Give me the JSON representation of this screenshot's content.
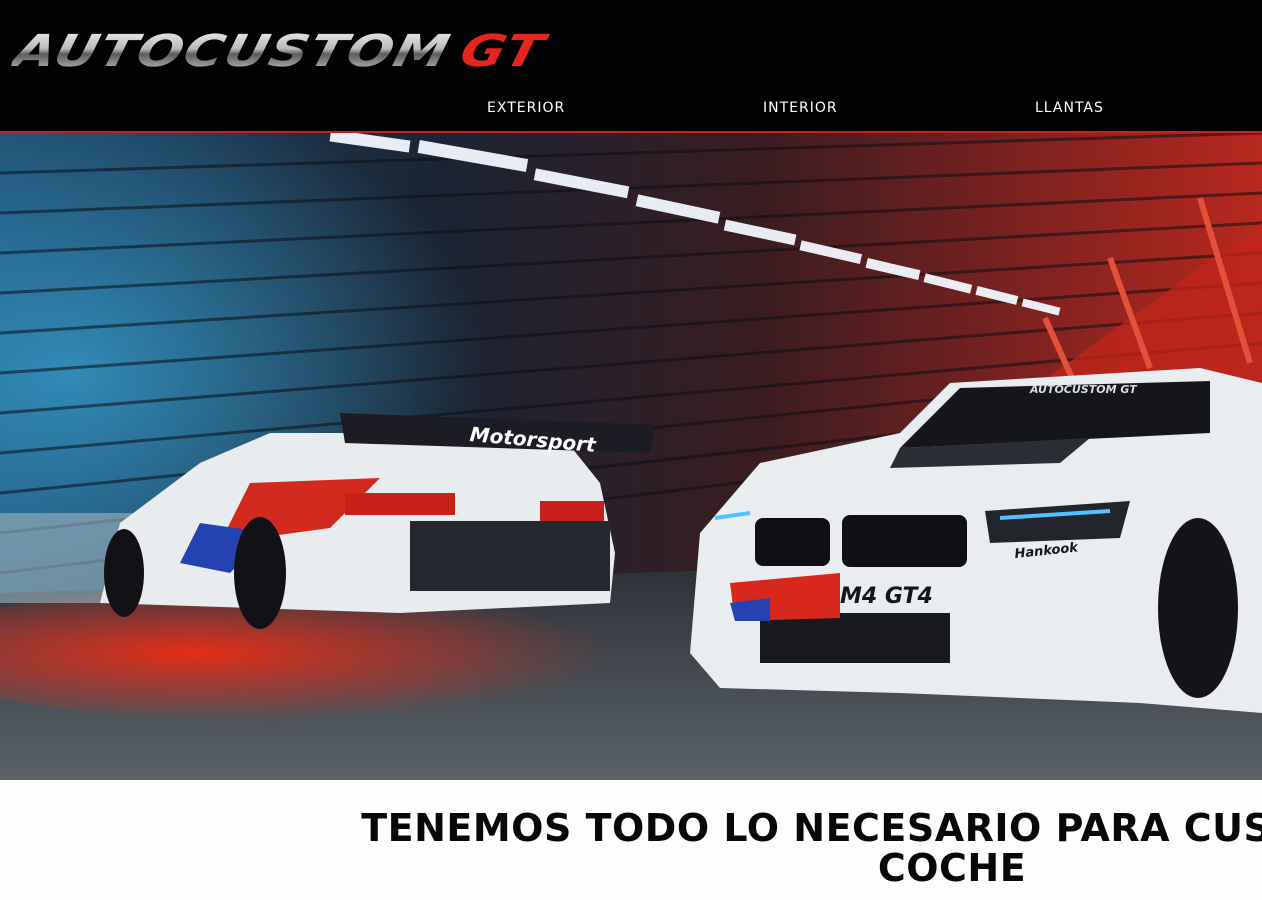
{
  "brand": {
    "logo_main": "AUTOCUSTOM",
    "logo_accent": "GT",
    "accent_color": "#e6261c"
  },
  "nav": {
    "items": [
      {
        "label": "EXTERIOR"
      },
      {
        "label": "INTERIOR"
      },
      {
        "label": "LLANTAS"
      }
    ]
  },
  "hero": {
    "car_left_wing_text": "Motorsport",
    "car_right_windshield_text": "AUTOCUSTOM GT",
    "car_right_model_text": "M4 GT4",
    "car_right_sponsor_text": "Hankook"
  },
  "headline": {
    "line1": "TENEMOS TODO LO NECESARIO PARA CUSTOMIZAR TU",
    "line2": "COCHE"
  }
}
